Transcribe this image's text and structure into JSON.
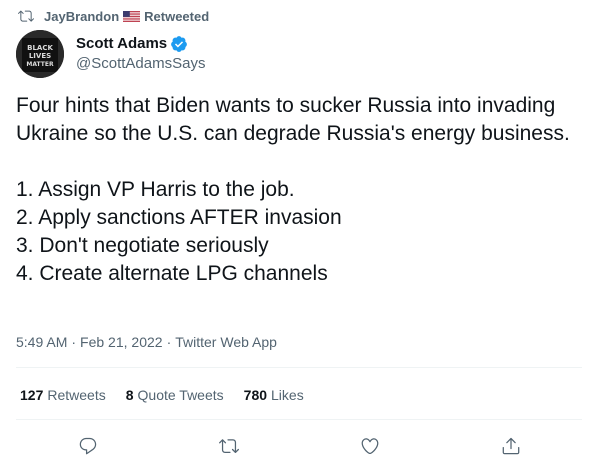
{
  "retweet_banner": {
    "user": "JayBrandon",
    "flag_icon": "us-flag-icon",
    "suffix": "Retweeted"
  },
  "author": {
    "name": "Scott Adams",
    "handle": "@ScottAdamsSays",
    "verified": true,
    "avatar_text": "BLACK LIVES MATTER"
  },
  "tweet": {
    "text": "Four hints that Biden wants to sucker Russia into invading Ukraine so the U.S. can degrade Russia's energy business.\n\n1. Assign VP Harris to the job.\n2. Apply sanctions AFTER invasion\n3. Don't negotiate seriously\n4. Create alternate LPG channels"
  },
  "meta": {
    "time": "5:49 AM",
    "date": "Feb 21, 2022",
    "source": "Twitter Web App",
    "separator": "·"
  },
  "stats": {
    "retweets_count": "127",
    "retweets_label": "Retweets",
    "quotes_count": "8",
    "quotes_label": "Quote Tweets",
    "likes_count": "780",
    "likes_label": "Likes"
  },
  "colors": {
    "text": "#0f1419",
    "secondary": "#536471",
    "verified": "#1d9bf0",
    "divider": "#eff3f4"
  },
  "actions": [
    "reply-icon",
    "retweet-icon",
    "like-icon",
    "share-icon"
  ]
}
